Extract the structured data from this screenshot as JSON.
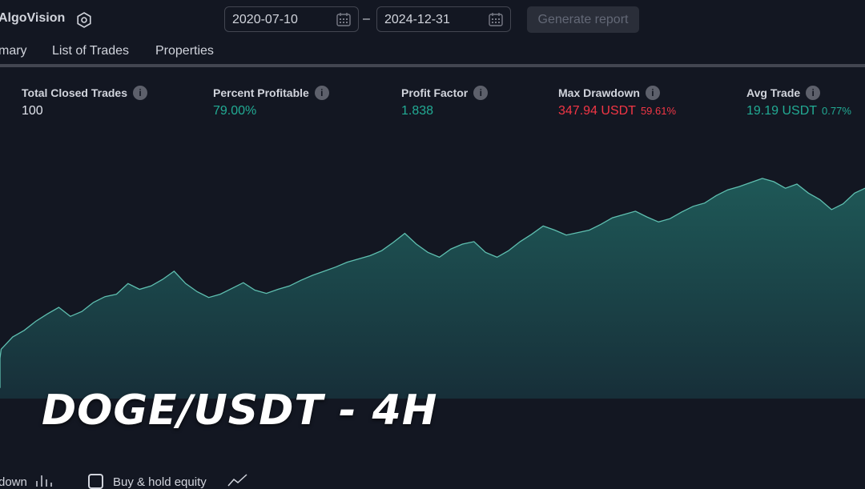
{
  "header": {
    "app_title": "AlgoVision",
    "date_from": "2020-07-10",
    "date_separator": "–",
    "date_to": "2024-12-31",
    "generate_label": "Generate report"
  },
  "tabs": [
    {
      "label": "mary"
    },
    {
      "label": "List of Trades"
    },
    {
      "label": "Properties"
    }
  ],
  "stats": [
    {
      "label": "Total Closed Trades",
      "value": "100",
      "pct": ""
    },
    {
      "label": "Percent Profitable",
      "value": "79.00%",
      "pct": ""
    },
    {
      "label": "Profit Factor",
      "value": "1.838",
      "pct": ""
    },
    {
      "label": "Max Drawdown",
      "value": "347.94 USDT",
      "pct": "59.61%"
    },
    {
      "label": "Avg Trade",
      "value": "19.19 USDT",
      "pct": "0.77%"
    }
  ],
  "overlay_title": "DOGE/USDT - 4H",
  "legend": {
    "drawdown_label": "down",
    "buy_hold_label": "Buy & hold equity"
  },
  "colors": {
    "background": "#131722",
    "positive": "#22ab94",
    "negative": "#f23645",
    "equity_line": "#5fbfb0"
  },
  "icons": [
    "settings-icon",
    "calendar-icon",
    "info-icon",
    "bar-chart-icon",
    "line-chart-icon"
  ],
  "chart_data": {
    "type": "area",
    "x_ticks": [
      15,
      22,
      29,
      36,
      43,
      50,
      57,
      64,
      71,
      78,
      85
    ],
    "x": [
      7,
      8,
      9,
      10,
      11,
      12,
      13,
      14,
      15,
      16,
      17,
      18,
      19,
      20,
      21,
      22,
      23,
      24,
      25,
      26,
      27,
      28,
      29,
      30,
      31,
      32,
      33,
      34,
      35,
      36,
      37,
      38,
      39,
      40,
      41,
      42,
      43,
      44,
      45,
      46,
      47,
      48,
      49,
      50,
      51,
      52,
      53,
      54,
      55,
      56,
      57,
      58,
      59,
      60,
      61,
      62,
      63,
      64,
      65,
      66,
      67,
      68,
      69,
      70,
      71,
      72,
      73,
      74,
      75,
      76,
      77,
      78,
      79,
      80,
      81,
      82,
      83,
      84,
      85,
      86
    ],
    "series": [
      {
        "values": [
          13,
          21,
          35,
          49,
          60,
          75,
          83,
          94,
          103,
          111,
          100,
          106,
          117,
          124,
          127,
          140,
          133,
          137,
          145,
          155,
          140,
          130,
          123,
          127,
          134,
          141,
          132,
          128,
          133,
          137,
          144,
          150,
          155,
          160,
          166,
          170,
          174,
          180,
          190,
          201,
          188,
          178,
          172,
          182,
          188,
          191,
          178,
          172,
          180,
          191,
          200,
          210,
          205,
          199,
          202,
          205,
          212,
          220,
          224,
          228,
          221,
          215,
          219,
          227,
          234,
          238,
          247,
          254,
          258,
          263,
          268,
          264,
          256,
          261,
          250,
          242,
          230,
          237,
          250,
          256
        ]
      }
    ],
    "ylim": [
      0,
      300
    ],
    "grid": false
  }
}
